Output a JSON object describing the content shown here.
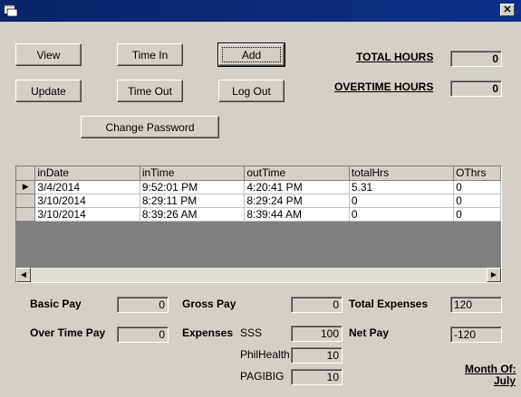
{
  "buttons": {
    "view": "View",
    "time_in": "Time In",
    "add": "Add",
    "update": "Update",
    "time_out": "Time Out",
    "log_out": "Log Out",
    "change_password": "Change Password"
  },
  "summary": {
    "total_hours_label": "TOTAL HOURS",
    "total_hours_value": "0",
    "overtime_hours_label": "OVERTIME HOURS",
    "overtime_hours_value": "0"
  },
  "grid": {
    "columns": [
      "inDate",
      "inTime",
      "outTime",
      "totalHrs",
      "OThrs"
    ],
    "rows": [
      [
        "3/4/2014",
        "9:52:01 PM",
        "4:20:41 PM",
        "5.31",
        "0"
      ],
      [
        "3/10/2014",
        "8:29:11 PM",
        "8:29:24 PM",
        "0",
        "0"
      ],
      [
        "3/10/2014",
        "8:39:26 AM",
        "8:39:44 AM",
        "0",
        "0"
      ]
    ],
    "current_row_marker": "▶"
  },
  "pay": {
    "basic_pay_label": "Basic Pay",
    "basic_pay_value": "0",
    "over_time_pay_label": "Over Time Pay",
    "over_time_pay_value": "0",
    "gross_pay_label": "Gross Pay",
    "gross_pay_value": "0",
    "expenses_label": "Expenses",
    "sss_label": "SSS",
    "sss_value": "100",
    "philhealth_label": "PhilHealth",
    "philhealth_value": "10",
    "pagibig_label": "PAGIBIG",
    "pagibig_value": "10",
    "total_expenses_label": "Total Expenses",
    "total_expenses_value": "120",
    "net_pay_label": "Net Pay",
    "net_pay_value": "-120",
    "month_label": "Month Of:",
    "month_value": "July"
  },
  "titlebar": {
    "close_glyph": "✕"
  },
  "scroll": {
    "left_glyph": "◀",
    "right_glyph": "▶"
  }
}
